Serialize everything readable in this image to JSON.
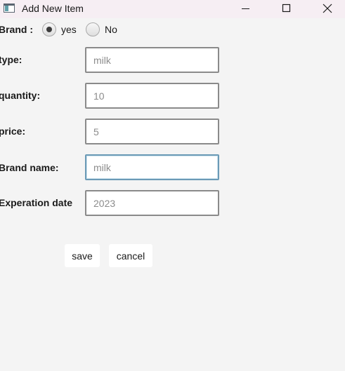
{
  "window": {
    "title": "Add New Item",
    "controls": [
      "minimize-icon",
      "maximize-icon",
      "close-icon"
    ]
  },
  "form": {
    "brand": {
      "label": "Brand :",
      "options": [
        {
          "label": "yes",
          "selected": true
        },
        {
          "label": "No",
          "selected": false
        }
      ]
    },
    "fields": {
      "type": {
        "label": "type:",
        "value": "milk"
      },
      "quantity": {
        "label": "quantity:",
        "value": "10"
      },
      "price": {
        "label": "price:",
        "value": "5"
      },
      "brand_name": {
        "label": "Brand name:",
        "value": "milk"
      },
      "expiration_date": {
        "label": "Experation date",
        "value": "2023"
      }
    },
    "focused_field": "brand_name"
  },
  "actions": {
    "save_label": "save",
    "cancel_label": "cancel"
  },
  "colors": {
    "background": "#f4f4f4",
    "titlebar": "#f6eef3",
    "input_border": "#8a8a8a",
    "focus_border": "#6b9ab6",
    "input_text": "#8c8c8c"
  }
}
